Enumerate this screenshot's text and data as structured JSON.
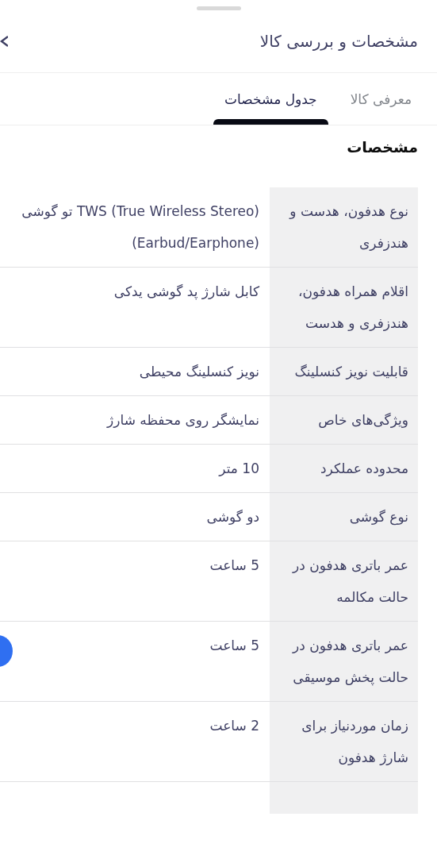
{
  "header": {
    "title": "مشخصات و بررسی کالا"
  },
  "tabs": [
    {
      "label": "معرفی کالا",
      "selected": false
    },
    {
      "label": "جدول مشخصات",
      "selected": true
    }
  ],
  "section_title": "مشخصات",
  "specs": [
    {
      "label": "نوع هدفون، هدست و هندزفری",
      "value": "TWS (True Wireless Stereo) تو گوشی (Earbud/Earphone)"
    },
    {
      "label": "اقلام همراه هدفون، هندزفری و هدست",
      "value": "کابل شارژ پد گوشی یدکی"
    },
    {
      "label": "قابلیت نویز کنسلینگ",
      "value": "نویز کنسلینگ محیطی"
    },
    {
      "label": "ویژگی‌های خاص",
      "value": "نمایشگر روی محفظه شارژ"
    },
    {
      "label": "محدوده عملکرد",
      "value": "10 متر"
    },
    {
      "label": "نوع گوشی",
      "value": "دو گوشی"
    },
    {
      "label": "عمر باتری هدفون در حالت مکالمه",
      "value": "5 ساعت"
    },
    {
      "label": "عمر باتری هدفون در حالت پخش موسیقی",
      "value": "5 ساعت"
    },
    {
      "label": "زمان موردنیاز برای شارژ هدفون",
      "value": "2 ساعت"
    }
  ]
}
